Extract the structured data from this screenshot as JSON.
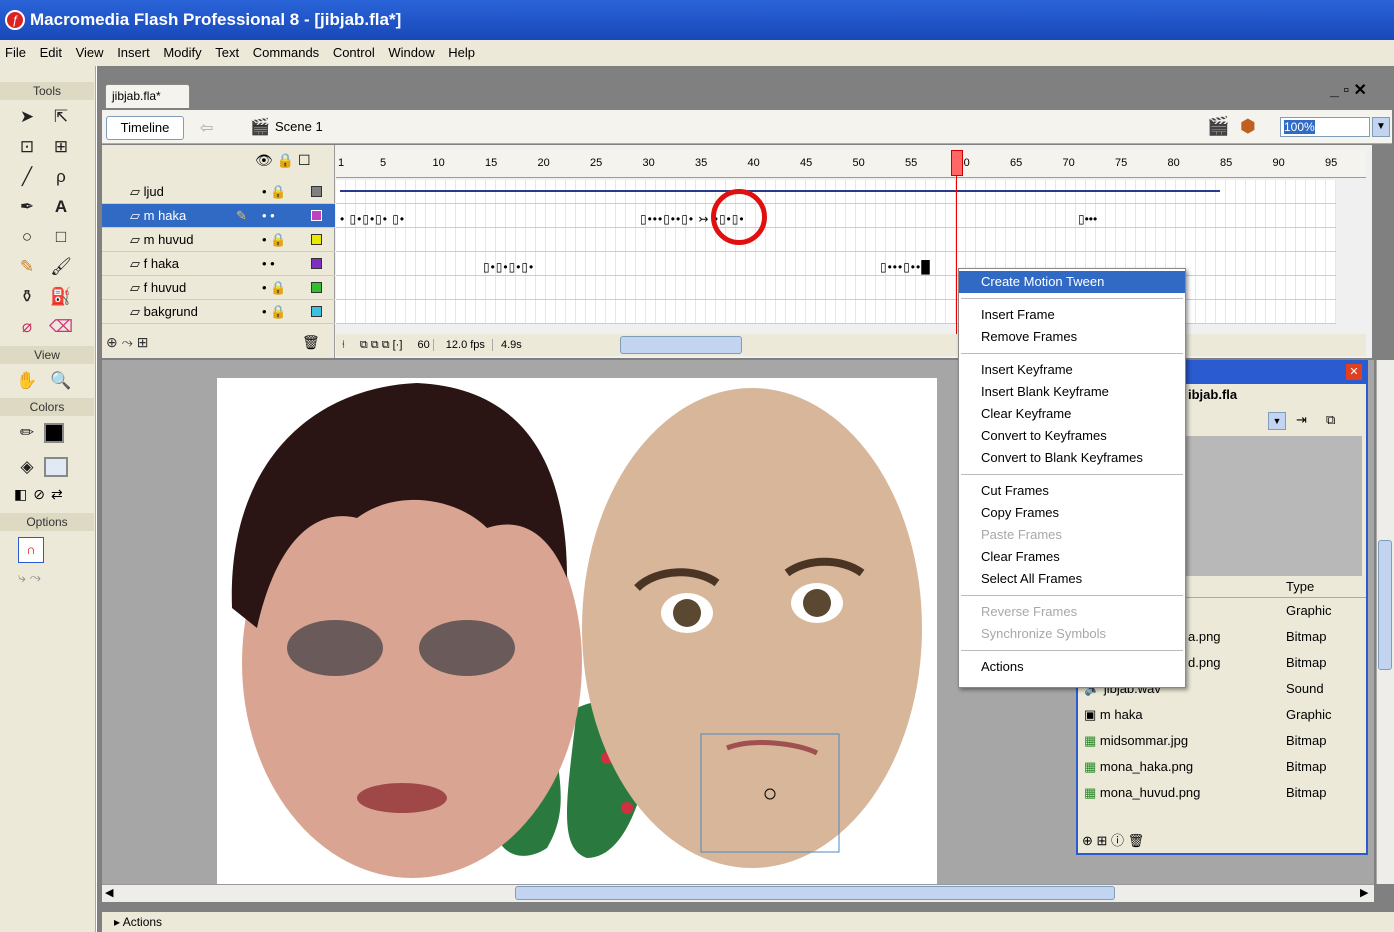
{
  "window": {
    "title": "Macromedia Flash Professional 8 - [jibjab.fla*]"
  },
  "menu": [
    "File",
    "Edit",
    "View",
    "Insert",
    "Modify",
    "Text",
    "Commands",
    "Control",
    "Window",
    "Help"
  ],
  "tools": {
    "heading": "Tools",
    "view_heading": "View",
    "colors_heading": "Colors",
    "options_heading": "Options"
  },
  "document": {
    "tab": "jibjab.fla*",
    "timeline_label": "Timeline",
    "scene": "Scene 1",
    "zoom": "100%",
    "win_controls": "_ ▫ ✕"
  },
  "timeline": {
    "ruler": [
      "1",
      "5",
      "10",
      "15",
      "20",
      "25",
      "30",
      "35",
      "40",
      "45",
      "50",
      "55",
      "60",
      "65",
      "70",
      "75",
      "80",
      "85",
      "90",
      "95"
    ],
    "layers": [
      {
        "name": "ljud",
        "color": "#808080"
      },
      {
        "name": "m haka",
        "color": "#c040c0",
        "selected": true
      },
      {
        "name": "m huvud",
        "color": "#e8e800"
      },
      {
        "name": "f haka",
        "color": "#8030c0"
      },
      {
        "name": "f huvud",
        "color": "#30c030"
      },
      {
        "name": "bakgrund",
        "color": "#40c0e0"
      }
    ],
    "current_frame": "60",
    "fps": "12.0 fps",
    "time": "4.9s"
  },
  "context_menu": {
    "groups": [
      [
        {
          "label": "Create Motion Tween",
          "highlight": true
        }
      ],
      [
        {
          "label": "Insert Frame"
        },
        {
          "label": "Remove Frames"
        }
      ],
      [
        {
          "label": "Insert Keyframe"
        },
        {
          "label": "Insert Blank Keyframe"
        },
        {
          "label": "Clear Keyframe"
        },
        {
          "label": "Convert to Keyframes"
        },
        {
          "label": "Convert to Blank Keyframes"
        }
      ],
      [
        {
          "label": "Cut Frames"
        },
        {
          "label": "Copy Frames"
        },
        {
          "label": "Paste Frames",
          "disabled": true
        },
        {
          "label": "Clear Frames"
        },
        {
          "label": "Select All Frames"
        }
      ],
      [
        {
          "label": "Reverse Frames",
          "disabled": true
        },
        {
          "label": "Synchronize Symbols",
          "disabled": true
        }
      ],
      [
        {
          "label": "Actions"
        }
      ]
    ]
  },
  "library": {
    "title": "ibjab.fla",
    "type_header": "Type",
    "items": [
      {
        "name": "",
        "type": "Graphic"
      },
      {
        "name": "a.png",
        "type": "Bitmap"
      },
      {
        "name": "d.png",
        "type": "Bitmap"
      },
      {
        "name": "jibjab.wav",
        "type": "Sound"
      },
      {
        "name": "m haka",
        "type": "Graphic"
      },
      {
        "name": "midsommar.jpg",
        "type": "Bitmap"
      },
      {
        "name": "mona_haka.png",
        "type": "Bitmap"
      },
      {
        "name": "mona_huvud.png",
        "type": "Bitmap"
      }
    ]
  },
  "actions_panel": {
    "label": "Actions"
  }
}
